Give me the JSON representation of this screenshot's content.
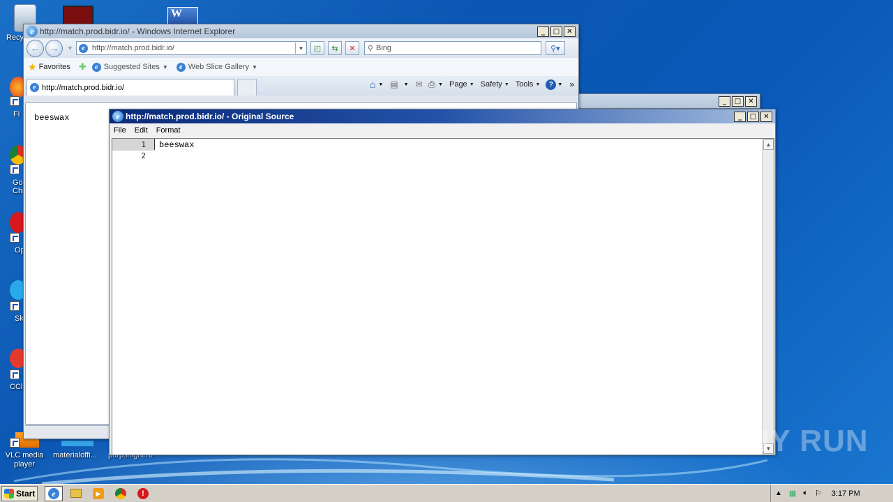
{
  "desktop": {
    "icons": [
      {
        "label": "Recy",
        "icon": "recycle-bin-icon"
      },
      {
        "label": "",
        "icon": "acrobat-icon"
      },
      {
        "label": "",
        "icon": "word-icon"
      },
      {
        "label": "Fi",
        "icon": "firefox-icon"
      },
      {
        "label": "Go\nChr",
        "icon": "chrome-icon"
      },
      {
        "label": "Op",
        "icon": "opera-icon"
      },
      {
        "label": "Sk",
        "icon": "skype-icon"
      },
      {
        "label": "CCl",
        "icon": "ccleaner-icon"
      }
    ],
    "bottom_icons": [
      {
        "label": "VLC media player",
        "icon": "vlc-icon"
      },
      {
        "label": "materialoffi...",
        "icon": "file-icon"
      },
      {
        "label": "purpsnight.rtf",
        "icon": "rtf-icon"
      }
    ],
    "watermark": "ANY RUN"
  },
  "ie": {
    "title": "http://match.prod.bidr.io/ - Windows Internet Explorer",
    "address": "http://match.prod.bidr.io/",
    "search_placeholder": "Bing",
    "favorites_label": "Favorites",
    "suggested_sites": "Suggested Sites",
    "web_slice_gallery": "Web Slice Gallery",
    "tab_title": "http://match.prod.bidr.io/",
    "commands": {
      "page": "Page",
      "safety": "Safety",
      "tools": "Tools"
    },
    "page_content": "beeswax"
  },
  "source_viewer": {
    "title": "http://match.prod.bidr.io/ - Original Source",
    "menu": [
      "File",
      "Edit",
      "Format"
    ],
    "lines": [
      {
        "num": "1",
        "text": "beeswax"
      },
      {
        "num": "2",
        "text": ""
      }
    ]
  },
  "taskbar": {
    "start_label": "Start",
    "clock": "3:17 PM"
  }
}
